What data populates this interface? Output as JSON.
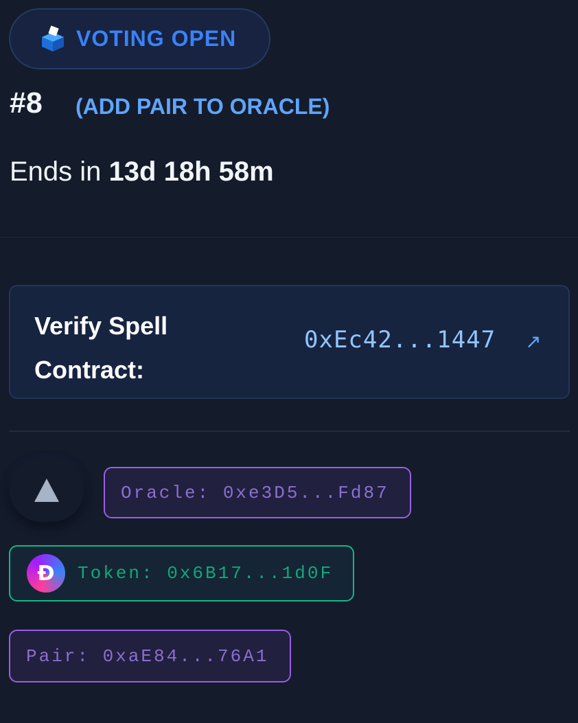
{
  "status": {
    "icon": "ballot-box-icon",
    "label": "VOTING OPEN",
    "color": "#3b82f6"
  },
  "proposal": {
    "number": "#8",
    "type": "(ADD PAIR TO ORACLE)",
    "ends_prefix": "Ends in",
    "ends_value": "13d 18h 58m"
  },
  "spell": {
    "label": "Verify Spell Contract:",
    "address": "0xEc42...1447",
    "link_icon": "external-link-icon"
  },
  "vote": {
    "icon": "upvote-triangle-icon"
  },
  "tags": {
    "oracle": "Oracle: 0xe3D5...Fd87",
    "token": "Token: 0x6B17...1d0F",
    "token_icon": "dai-token-icon",
    "pair": "Pair: 0xaE84...76A1"
  },
  "colors": {
    "background": "#141b2b",
    "accent_blue": "#3b82f6",
    "oracle_purple": "#9b5de5",
    "token_green": "#10b981"
  }
}
